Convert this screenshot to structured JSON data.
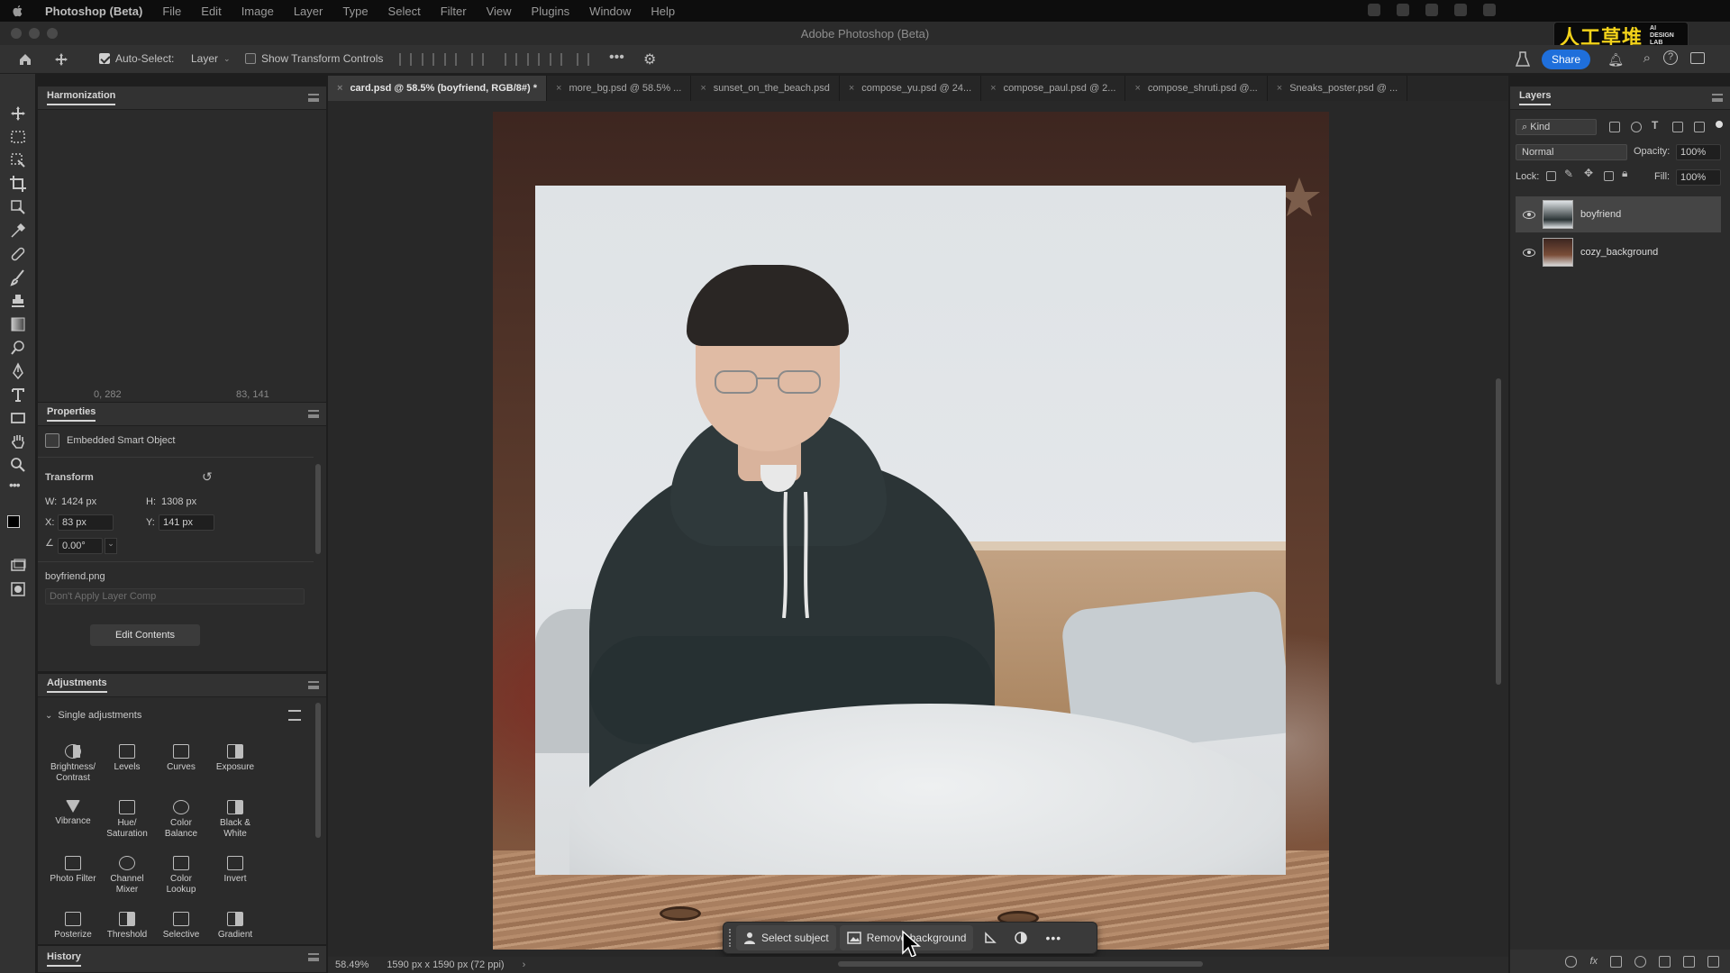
{
  "menubar": {
    "app_name": "Photoshop (Beta)",
    "items": [
      "File",
      "Edit",
      "Image",
      "Layer",
      "Type",
      "Select",
      "Filter",
      "View",
      "Plugins",
      "Window",
      "Help"
    ]
  },
  "window": {
    "title": "Adobe Photoshop (Beta)"
  },
  "watermark": {
    "main": "人工草堆",
    "sub_1": "AI",
    "sub_2": "DESIGN",
    "sub_3": "LAB"
  },
  "options_bar": {
    "auto_select_label": "Auto-Select:",
    "auto_select_value": "Layer",
    "show_transform_label": "Show Transform Controls",
    "share_label": "Share"
  },
  "doc_tabs": [
    {
      "label": "card.psd @ 58.5% (boyfriend, RGB/8#) *",
      "active": true
    },
    {
      "label": "more_bg.psd @ 58.5% ..."
    },
    {
      "label": "sunset_on_the_beach.psd"
    },
    {
      "label": "compose_yu.psd @ 24..."
    },
    {
      "label": "compose_paul.psd @ 2..."
    },
    {
      "label": "compose_shruti.psd @..."
    },
    {
      "label": "Sneaks_poster.psd @ ..."
    }
  ],
  "harmonization": {
    "title": "Harmonization",
    "coord_left": "0, 282",
    "coord_right": "83, 141"
  },
  "properties": {
    "title": "Properties",
    "object_type": "Embedded Smart Object",
    "transform_label": "Transform",
    "w_label": "W:",
    "w_value": "1424 px",
    "h_label": "H:",
    "h_value": "1308 px",
    "x_label": "X:",
    "x_value": "83 px",
    "y_label": "Y:",
    "y_value": "141 px",
    "angle_value": "0.00°",
    "filename": "boyfriend.png",
    "layer_comp_placeholder": "Don't Apply Layer Comp",
    "edit_contents_label": "Edit Contents"
  },
  "adjustments": {
    "title": "Adjustments",
    "section_label": "Single adjustments",
    "items": [
      {
        "line1": "Brightness/",
        "line2": "Contrast"
      },
      {
        "line1": "Levels",
        "line2": ""
      },
      {
        "line1": "Curves",
        "line2": ""
      },
      {
        "line1": "Exposure",
        "line2": ""
      },
      {
        "line1": "Vibrance",
        "line2": ""
      },
      {
        "line1": "Hue/",
        "line2": "Saturation"
      },
      {
        "line1": "Color",
        "line2": "Balance"
      },
      {
        "line1": "Black &",
        "line2": "White"
      },
      {
        "line1": "Photo Filter",
        "line2": ""
      },
      {
        "line1": "Channel",
        "line2": "Mixer"
      },
      {
        "line1": "Color",
        "line2": "Lookup"
      },
      {
        "line1": "Invert",
        "line2": ""
      },
      {
        "line1": "Posterize",
        "line2": ""
      },
      {
        "line1": "Threshold",
        "line2": ""
      },
      {
        "line1": "Selective",
        "line2": ""
      },
      {
        "line1": "Gradient",
        "line2": ""
      }
    ]
  },
  "history": {
    "title": "History"
  },
  "context_bar": {
    "select_subject_label": "Select subject",
    "remove_background_label": "Remove background"
  },
  "status": {
    "zoom": "58.49%",
    "doc_info": "1590 px x 1590 px (72 ppi)"
  },
  "layers": {
    "title": "Layers",
    "filter_kind": "Kind",
    "blend_mode": "Normal",
    "opacity_label": "Opacity:",
    "opacity_value": "100%",
    "lock_label": "Lock:",
    "fill_label": "Fill:",
    "fill_value": "100%",
    "items": [
      {
        "name": "boyfriend",
        "selected": true
      },
      {
        "name": "cozy_background",
        "selected": false
      }
    ]
  },
  "colors": {
    "accent": "#1f6fdb",
    "watermark_yellow": "#f2d21a"
  }
}
